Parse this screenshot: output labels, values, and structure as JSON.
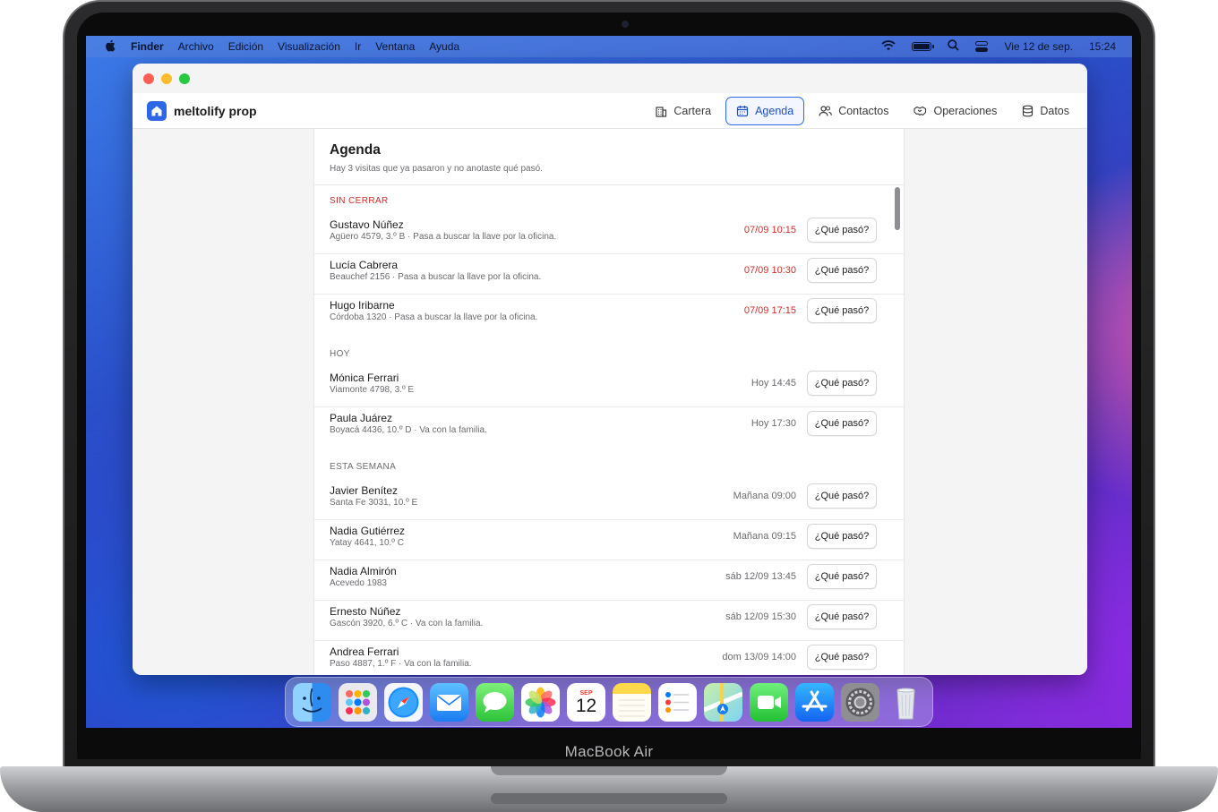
{
  "device": {
    "label": "MacBook Air"
  },
  "menubar": {
    "apple_icon": "apple-logo",
    "app_name": "Finder",
    "menus": [
      "Archivo",
      "Edición",
      "Visualización",
      "Ir",
      "Ventana",
      "Ayuda"
    ],
    "status_icons": [
      "wifi-icon",
      "battery-icon",
      "spotlight-search-icon",
      "control-center-icon"
    ],
    "date": "Vie 12 de sep.",
    "time": "15:24"
  },
  "app": {
    "brand": "meltolify prop",
    "accent": "#2e67e6",
    "tabs": [
      {
        "label": "Cartera",
        "icon": "building-icon"
      },
      {
        "label": "Agenda",
        "icon": "calendar-icon",
        "active": true
      },
      {
        "label": "Contactos",
        "icon": "people-icon"
      },
      {
        "label": "Operaciones",
        "icon": "handshake-icon"
      },
      {
        "label": "Datos",
        "icon": "database-icon"
      }
    ]
  },
  "agenda": {
    "title": "Agenda",
    "subtitle": "Hay 3 visitas que ya pasaron y no anotaste qué pasó.",
    "action_label": "¿Qué pasó?",
    "sections": [
      {
        "label": "SIN CERRAR",
        "overdue": true,
        "items": [
          {
            "name": "Gustavo Núñez",
            "detail": "Agüero 4579, 3.º B · Pasa a buscar la llave por la oficina.",
            "time": "07/09 10:15"
          },
          {
            "name": "Lucía Cabrera",
            "detail": "Beauchef 2156 · Pasa a buscar la llave por la oficina.",
            "time": "07/09 10:30"
          },
          {
            "name": "Hugo Iribarne",
            "detail": "Córdoba 1320 · Pasa a buscar la llave por la oficina.",
            "time": "07/09 17:15"
          }
        ]
      },
      {
        "label": "HOY",
        "overdue": false,
        "items": [
          {
            "name": "Mónica Ferrari",
            "detail": "Viamonte 4798, 3.º E",
            "time": "Hoy 14:45"
          },
          {
            "name": "Paula Juárez",
            "detail": "Boyacá 4436, 10.º D · Va con la familia.",
            "time": "Hoy 17:30"
          }
        ]
      },
      {
        "label": "ESTA SEMANA",
        "overdue": false,
        "items": [
          {
            "name": "Javier Benítez",
            "detail": "Santa Fe 3031, 10.º E",
            "time": "Mañana 09:00"
          },
          {
            "name": "Nadia Gutiérrez",
            "detail": "Yatay 4641, 10.º C",
            "time": "Mañana 09:15"
          },
          {
            "name": "Nadia Almirón",
            "detail": "Acevedo 1983",
            "time": "sáb 12/09 13:45"
          },
          {
            "name": "Ernesto Núñez",
            "detail": "Gascón 3920, 6.º C · Va con la familia.",
            "time": "sáb 12/09 15:30"
          },
          {
            "name": "Andrea Ferrari",
            "detail": "Paso 4887, 1.º F · Va con la familia.",
            "time": "dom 13/09 14:00"
          }
        ]
      }
    ]
  },
  "dock": {
    "apps": [
      "finder-icon",
      "launchpad-icon",
      "safari-icon",
      "mail-icon",
      "messages-icon",
      "photos-icon",
      "calendar-icon",
      "notes-icon",
      "reminders-icon",
      "maps-icon",
      "facetime-icon",
      "app-store-icon",
      "system-settings-icon",
      "trash-icon"
    ],
    "calendar_month": "SEP",
    "calendar_day": "12"
  }
}
